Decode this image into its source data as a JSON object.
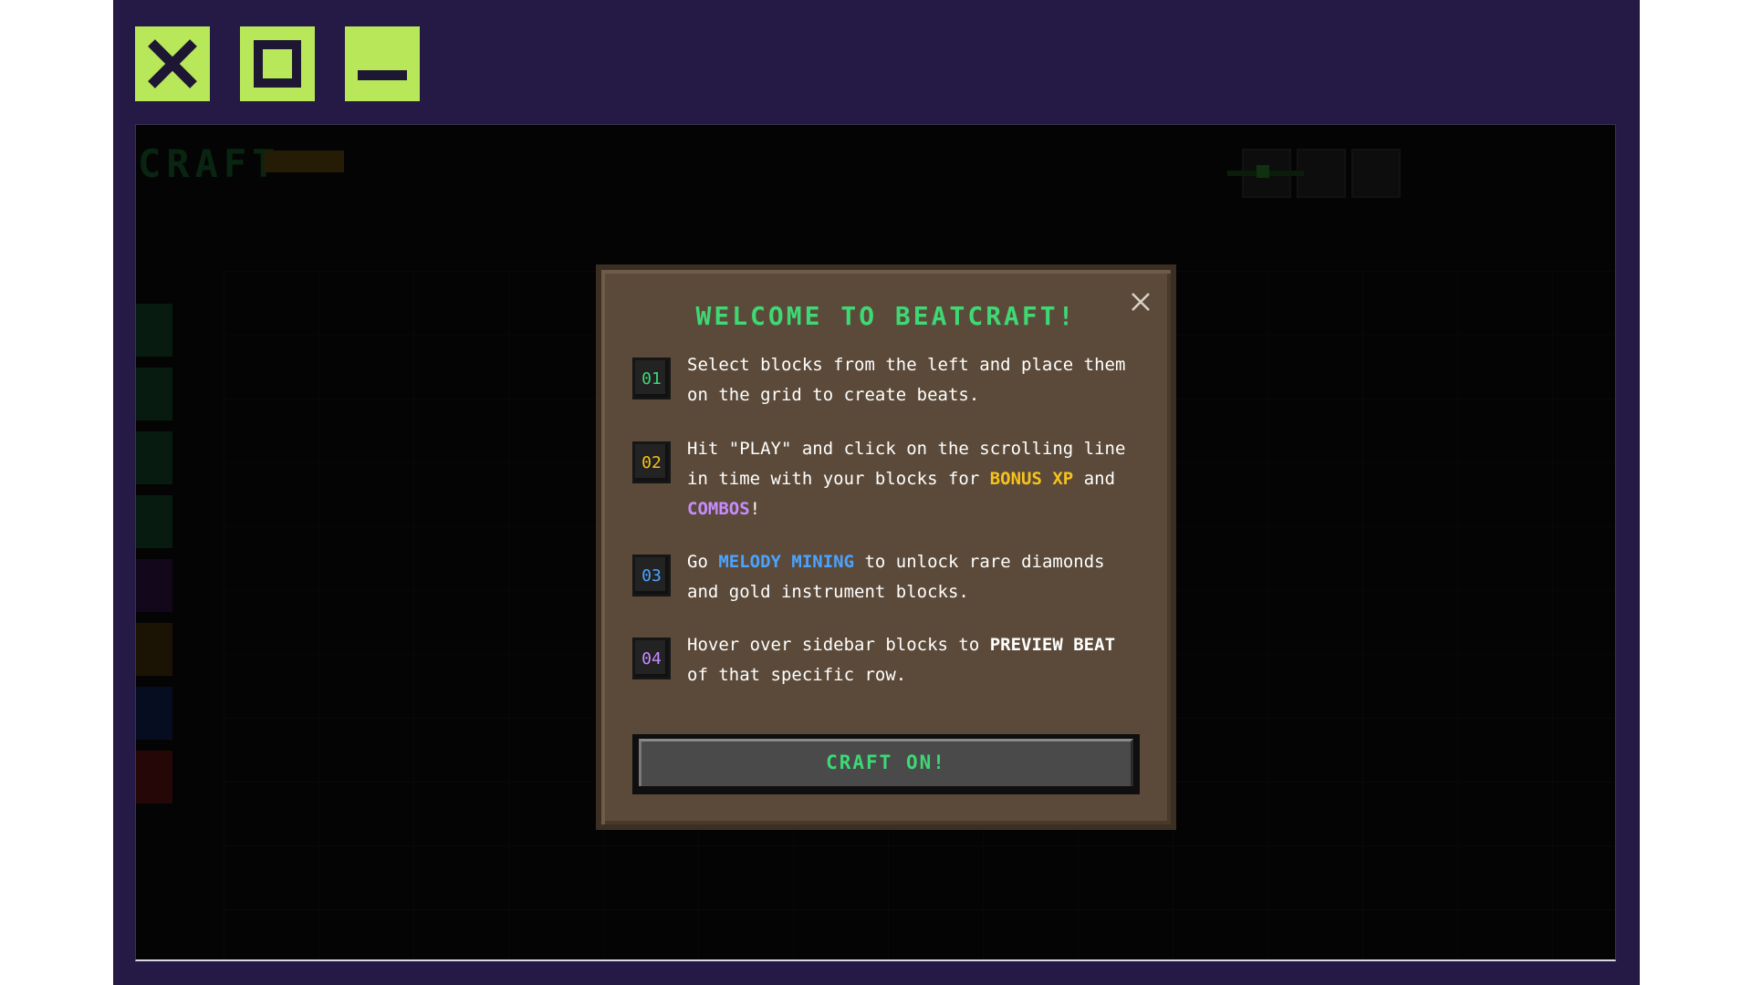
{
  "window_controls": {
    "close": "close-icon",
    "maximize": "maximize-icon",
    "minimize": "minimize-icon",
    "color": "#b8e85a"
  },
  "background_app": {
    "title": "CRAFT"
  },
  "modal": {
    "title": "WELCOME TO BEATCRAFT!",
    "steps": [
      {
        "num": "01",
        "num_color": "#3ed874",
        "text_parts": [
          "Select blocks from the left and place them on the grid to create beats."
        ]
      },
      {
        "num": "02",
        "num_color": "#f7c21b",
        "text_parts": [
          "Hit \"PLAY\" and click on the scrolling line in time with your blocks for ",
          "BONUS XP",
          " and ",
          "COMBOS",
          "!"
        ]
      },
      {
        "num": "03",
        "num_color": "#4aa3ff",
        "text_parts": [
          "Go ",
          "MELODY MINING",
          " to unlock rare diamonds and gold instrument blocks."
        ]
      },
      {
        "num": "04",
        "num_color": "#c68cff",
        "text_parts": [
          "Hover over sidebar blocks to ",
          "PREVIEW BEAT",
          " of that specific row."
        ]
      }
    ],
    "cta_label": "CRAFT ON!"
  }
}
